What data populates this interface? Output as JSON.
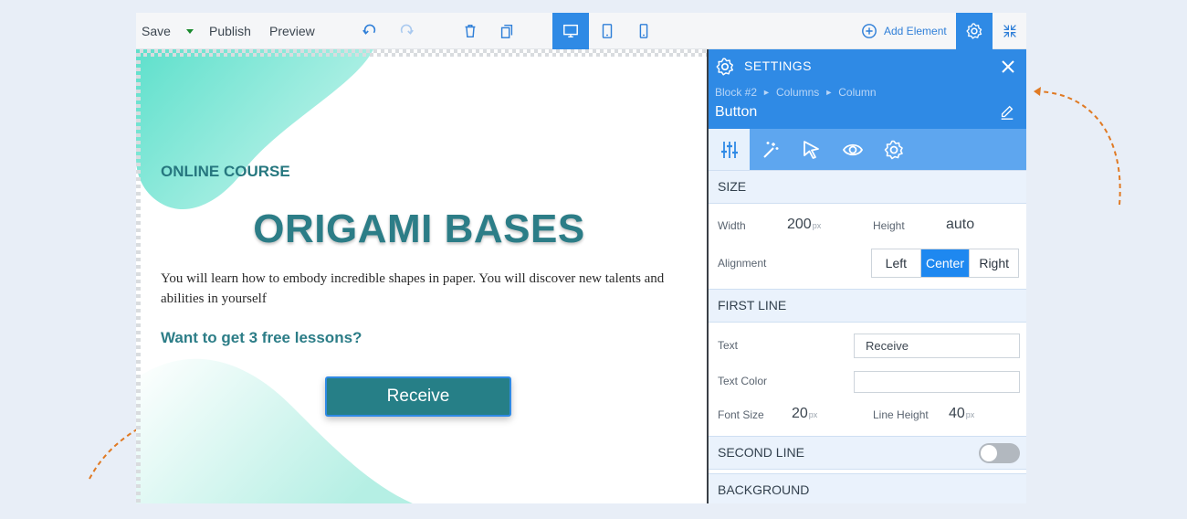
{
  "toolbar": {
    "save": "Save",
    "publish": "Publish",
    "preview": "Preview",
    "add_element": "Add Element"
  },
  "canvas": {
    "label": "ONLINE COURSE",
    "title": "ORIGAMI BASES",
    "description": "You will learn how to embody incredible shapes in paper. You will discover new talents and abilities in yourself",
    "question": "Want to get 3 free lessons?",
    "button": "Receive"
  },
  "panel": {
    "title": "SETTINGS",
    "breadcrumb": [
      "Block #2",
      "Columns",
      "Column"
    ],
    "element_name": "Button",
    "sections": {
      "size": "SIZE",
      "first_line": "FIRST LINE",
      "second_line": "SECOND LINE",
      "background": "BACKGROUND"
    },
    "size": {
      "width_label": "Width",
      "width_value": "200",
      "width_unit": "px",
      "height_label": "Height",
      "height_value": "auto",
      "alignment_label": "Alignment",
      "alignment_options": [
        "Left",
        "Center",
        "Right"
      ]
    },
    "first_line": {
      "text_label": "Text",
      "text_value": "Receive",
      "color_label": "Text Color",
      "color_value": "",
      "font_size_label": "Font Size",
      "font_size_value": "20",
      "font_size_unit": "px",
      "line_height_label": "Line Height",
      "line_height_value": "40",
      "line_height_unit": "px"
    },
    "second_line_enabled": false
  },
  "colors": {
    "accent": "#2f8ae5",
    "button": "#267f87",
    "heading": "#2c7d87",
    "arrow": "#e07a24"
  }
}
